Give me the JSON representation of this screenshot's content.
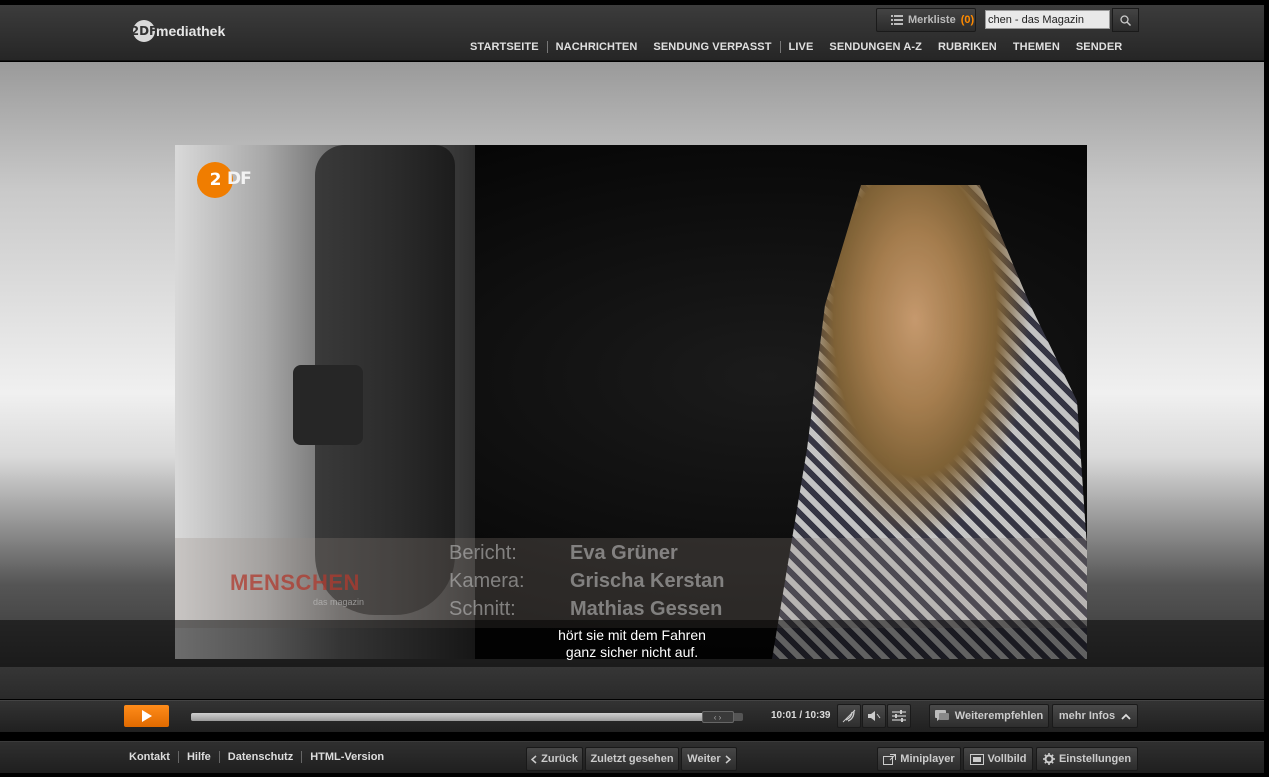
{
  "header": {
    "logo_text": "mediathek",
    "logo_mark": "2DF",
    "merkliste_label": "Merkliste",
    "merkliste_count": "(0)",
    "search_value": "chen - das Magazin",
    "nav": [
      "STARTSEITE",
      "NACHRICHTEN",
      "SENDUNG VERPASST",
      "LIVE",
      "SENDUNGEN A-Z",
      "RUBRIKEN",
      "THEMEN",
      "SENDER"
    ]
  },
  "video": {
    "channel_badge": "2",
    "channel_badge_text": "DF",
    "show_logo": "MENSCHEN",
    "show_sub": "das magazin",
    "credits": [
      {
        "label": "Bericht:",
        "value": "Eva Grüner"
      },
      {
        "label": "Kamera:",
        "value": "Grischa Kerstan"
      },
      {
        "label": "Schnitt:",
        "value": "Mathias Gessen"
      }
    ],
    "subtitle_line1": "hört sie mit dem Fahren",
    "subtitle_line2": "ganz sicher nicht auf."
  },
  "player": {
    "progress": 0.9539,
    "handle_label": "‹ ›",
    "time": "10:01 / 10:39",
    "recommend_label": "Weiterempfehlen",
    "more_info_label": "mehr Infos"
  },
  "footer": {
    "links": [
      "Kontakt",
      "Hilfe",
      "Datenschutz",
      "HTML-Version"
    ],
    "back_label": "Zurück",
    "recent_label": "Zuletzt gesehen",
    "next_label": "Weiter",
    "miniplayer_label": "Miniplayer",
    "fullscreen_label": "Vollbild",
    "settings_label": "Einstellungen"
  },
  "colors": {
    "accent": "#f07d00",
    "merkliste_count": "#ff8a00"
  }
}
